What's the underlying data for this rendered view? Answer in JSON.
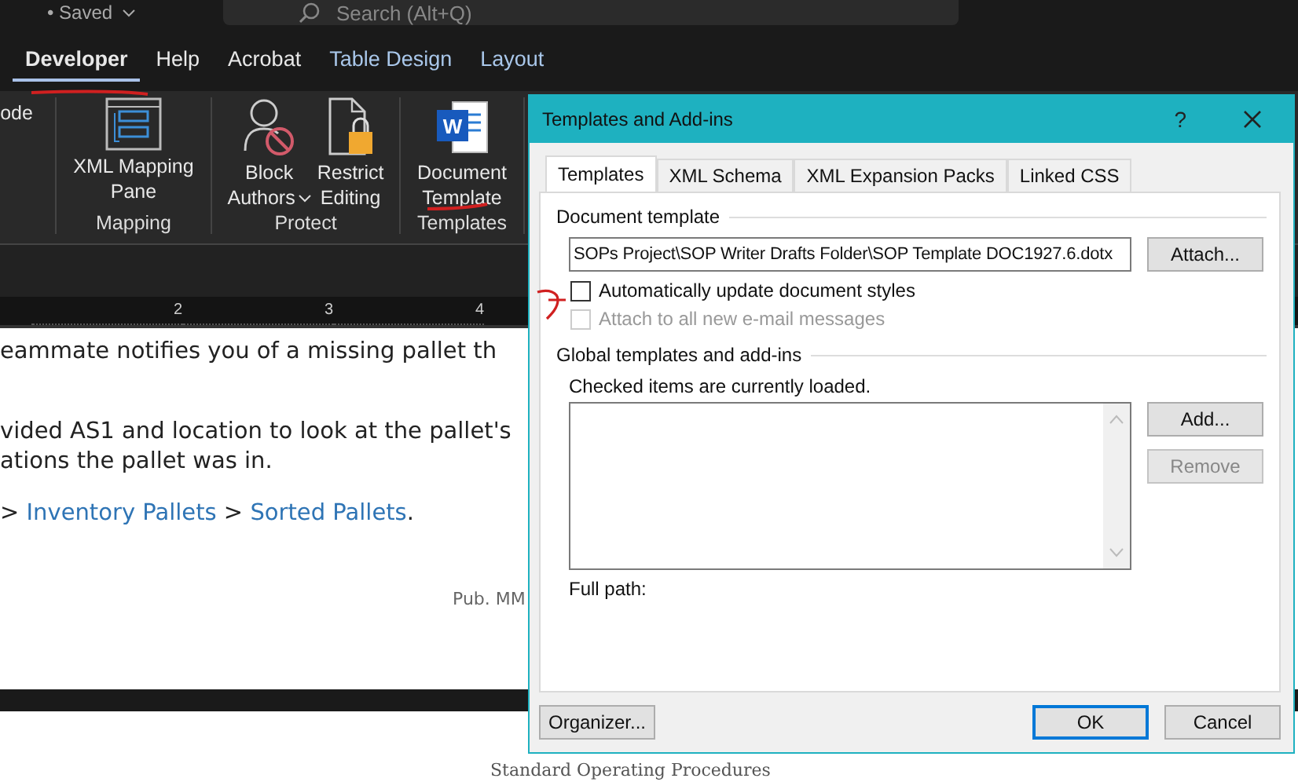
{
  "title_bar": {
    "save_status": "• Saved",
    "search": {
      "placeholder": "Search (Alt+Q)"
    }
  },
  "ribbon_tabs": [
    {
      "label": "Developer",
      "selected": true,
      "kind": "standard"
    },
    {
      "label": "Help",
      "selected": false,
      "kind": "standard"
    },
    {
      "label": "Acrobat",
      "selected": false,
      "kind": "standard"
    },
    {
      "label": "Table Design",
      "selected": false,
      "kind": "contextual"
    },
    {
      "label": "Layout",
      "selected": false,
      "kind": "contextual"
    }
  ],
  "ribbon_groups": [
    {
      "commands": [
        {
          "lines": [
            "ode"
          ],
          "dropdown": false
        }
      ]
    },
    {
      "label": "Mapping",
      "commands": [
        {
          "lines": [
            "XML Mapping",
            "Pane"
          ],
          "dropdown": false
        }
      ]
    },
    {
      "label": "Protect",
      "commands": [
        {
          "lines": [
            "Block",
            "Authors"
          ],
          "dropdown": true
        },
        {
          "lines": [
            "Restrict",
            "Editing"
          ],
          "dropdown": false
        }
      ]
    },
    {
      "label": "Templates",
      "commands": [
        {
          "lines": [
            "Document",
            "Template"
          ],
          "icon_letter": "W",
          "dropdown": false
        }
      ]
    }
  ],
  "document": {
    "ruler_numbers": [
      "2",
      "3",
      "4"
    ],
    "paragraphs": [
      {
        "kind": "text",
        "text": "eammate notifies you of a missing pallet th"
      },
      {
        "kind": "text",
        "text": "vided AS1 and location to look at the pallet's"
      },
      {
        "kind": "text",
        "text": "ations the pallet was in."
      },
      {
        "kind": "path",
        "parts": [
          {
            "kind": "text",
            "text": "> "
          },
          {
            "kind": "link",
            "text": "Inventory Pallets"
          },
          {
            "kind": "text",
            "text": " > "
          },
          {
            "kind": "link",
            "text": "Sorted Pallets"
          },
          {
            "kind": "text",
            "text": "."
          }
        ]
      }
    ],
    "footer": "Pub. MM",
    "next_page_heading": "Standard Operating Procedures"
  },
  "dialog": {
    "title": "Templates and Add-ins",
    "help": "?",
    "tabs": [
      {
        "label": "Templates",
        "selected": true
      },
      {
        "label": "XML Schema",
        "selected": false
      },
      {
        "label": "XML Expansion Packs",
        "selected": false
      },
      {
        "label": "Linked CSS",
        "selected": false
      }
    ],
    "document_template": {
      "label": "Document template",
      "value": "SOPs Project\\SOP Writer Drafts Folder\\SOP Template DOC1927.6.dotx",
      "attach_button": "Attach..."
    },
    "checkboxes": [
      {
        "label": "Automatically update document styles",
        "checked": false,
        "disabled": false
      },
      {
        "label": "Attach to all new e-mail messages",
        "checked": false,
        "disabled": true
      }
    ],
    "global": {
      "label": "Global templates and add-ins",
      "hint": "Checked items are currently loaded.",
      "buttons": [
        {
          "label": "Add...",
          "disabled": false
        },
        {
          "label": "Remove",
          "disabled": true
        }
      ],
      "full_path_label": "Full path:"
    },
    "buttons": [
      {
        "label": "Organizer...",
        "kind": "left",
        "default": false
      },
      {
        "label": "OK",
        "kind": "right",
        "default": true
      },
      {
        "label": "Cancel",
        "kind": "right",
        "default": false
      }
    ]
  }
}
